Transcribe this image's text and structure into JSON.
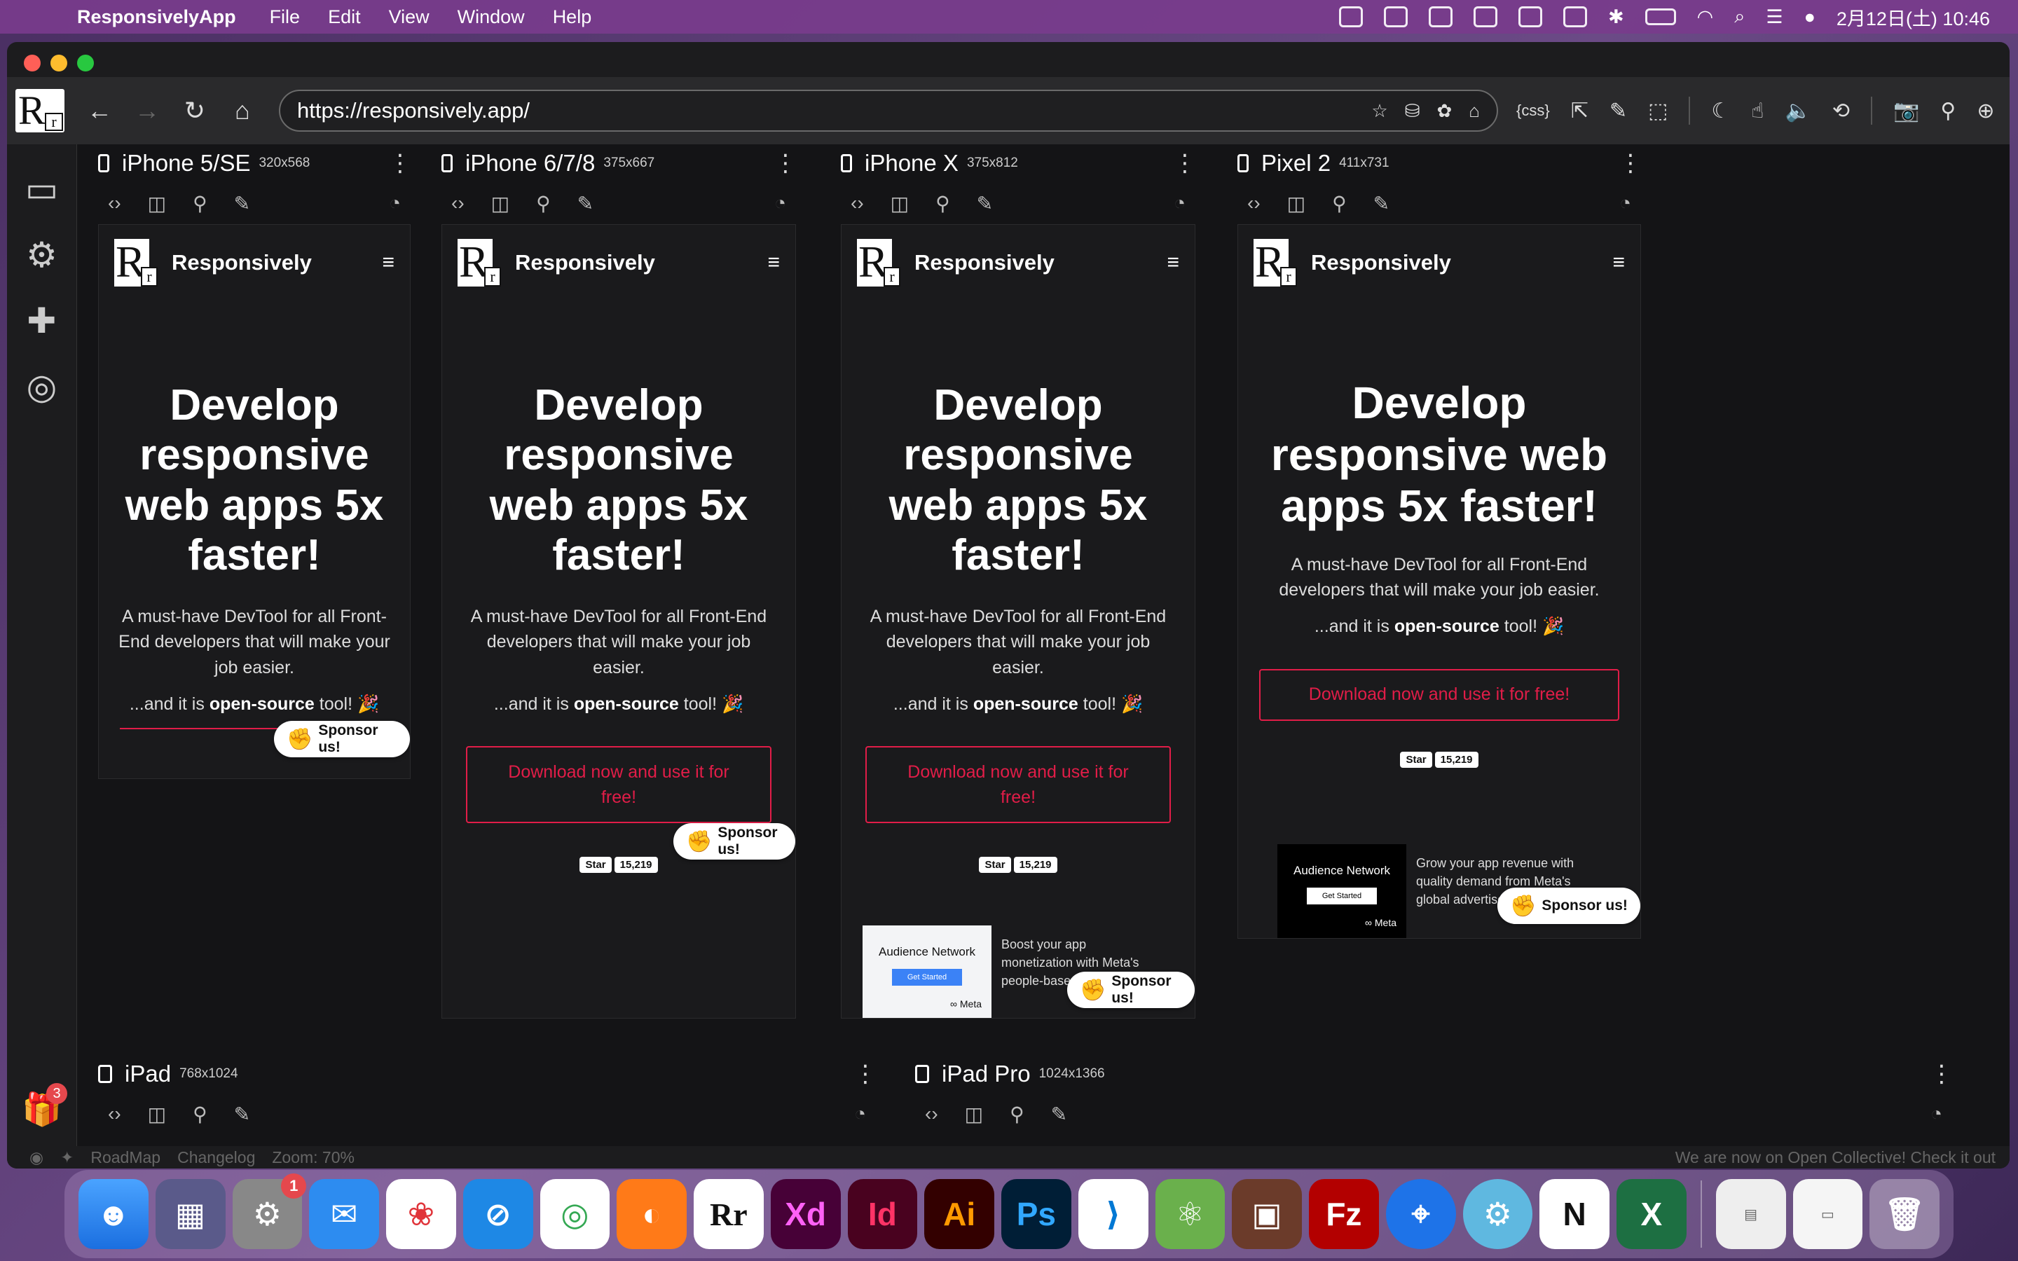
{
  "menubar": {
    "app_name": "ResponsivelyApp",
    "menus": [
      "File",
      "Edit",
      "View",
      "Window",
      "Help"
    ],
    "clock": "2月12日(土) 10:46"
  },
  "toolbar": {
    "url": "https://responsively.app/",
    "css_label": "{css}"
  },
  "devices": [
    {
      "name": "iPhone 5/SE",
      "size": "320x568"
    },
    {
      "name": "iPhone 6/7/8",
      "size": "375x667"
    },
    {
      "name": "iPhone X",
      "size": "375x812"
    },
    {
      "name": "Pixel 2",
      "size": "411x731"
    },
    {
      "name": "iPad",
      "size": "768x1024"
    },
    {
      "name": "iPad Pro",
      "size": "1024x1366"
    }
  ],
  "site": {
    "brand": "Responsively",
    "hero": "Develop responsive web apps 5x faster!",
    "sub": "A must-have DevTool for all Front-End developers that will make your job easier.",
    "oss_prefix": "...and it is ",
    "oss_bold": "open-source",
    "oss_suffix": " tool! 🎉",
    "cta": "Download now and use it for free!",
    "star_label": "Star",
    "star_count": "15,219",
    "sponsor": "Sponsor us!",
    "ad_title": "Audience Network",
    "ad_button": "Get Started",
    "ad_meta": "∞ Meta",
    "ad_text_a": "Boost your app monetization with Meta's people-based solutions",
    "ad_text_b": "Grow your app revenue with quality demand from Meta's global advertisers"
  },
  "sidebar": {
    "gift_badge": "3"
  },
  "statusbar": {
    "roadmap": "RoadMap",
    "changelog": "Changelog",
    "zoom": "Zoom: 70%",
    "notice": "We are now on Open Collective! Check it out"
  },
  "dock": {
    "settings_badge": "1"
  }
}
